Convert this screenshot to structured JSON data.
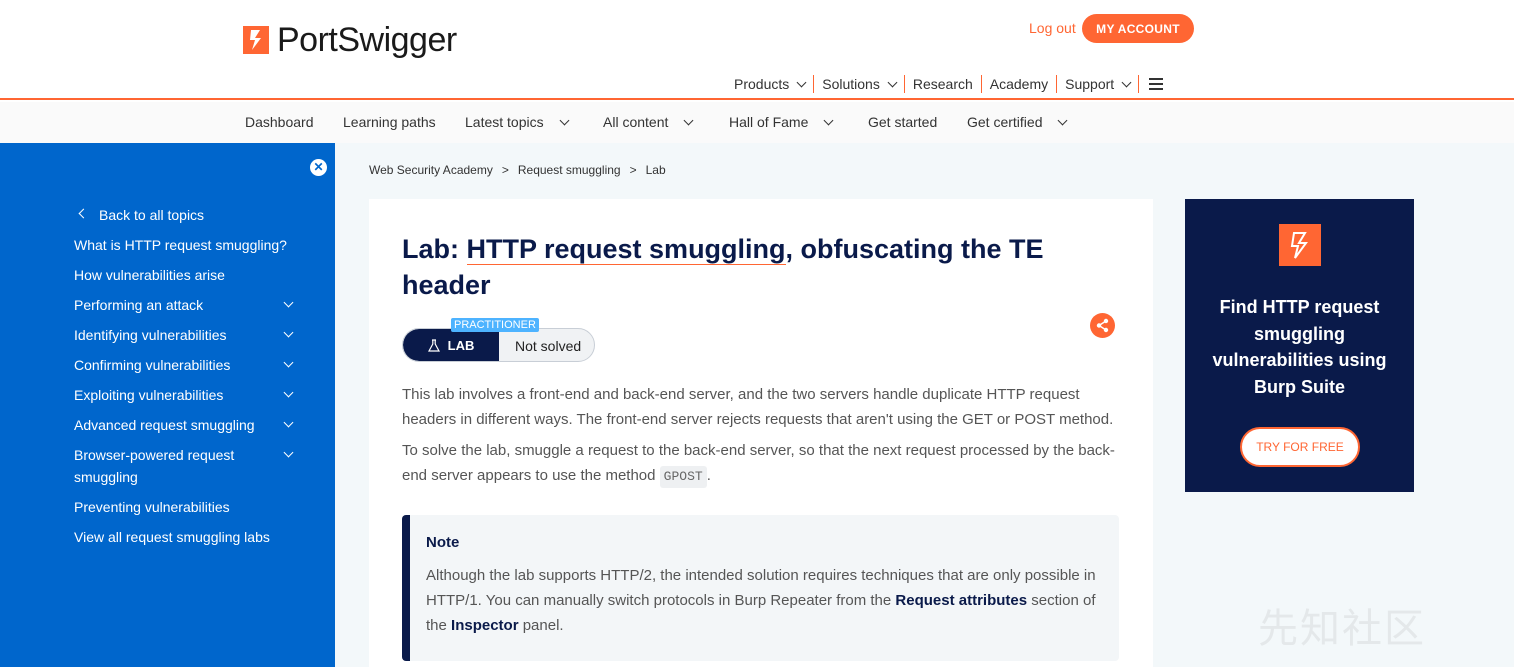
{
  "header": {
    "logo_text": "PortSwigger",
    "logout_label": "Log out",
    "account_label": "MY ACCOUNT",
    "nav": [
      {
        "label": "Products",
        "dropdown": true
      },
      {
        "label": "Solutions",
        "dropdown": true
      },
      {
        "label": "Research",
        "dropdown": false
      },
      {
        "label": "Academy",
        "dropdown": false
      },
      {
        "label": "Support",
        "dropdown": true
      }
    ]
  },
  "subnav": {
    "items": [
      {
        "label": "Dashboard"
      },
      {
        "label": "Learning paths"
      },
      {
        "label": "Latest topics"
      },
      {
        "label": "All content"
      },
      {
        "label": "Hall of Fame"
      },
      {
        "label": "Get started"
      },
      {
        "label": "Get certified"
      }
    ]
  },
  "sidebar": {
    "back_label": "Back to all topics",
    "items": [
      {
        "label": "What is HTTP request smuggling?"
      },
      {
        "label": "How vulnerabilities arise"
      },
      {
        "label": "Performing an attack"
      },
      {
        "label": "Identifying vulnerabilities"
      },
      {
        "label": "Confirming vulnerabilities"
      },
      {
        "label": "Exploiting vulnerabilities"
      },
      {
        "label": "Advanced request smuggling"
      },
      {
        "label": "Browser-powered request smuggling"
      },
      {
        "label": "Preventing vulnerabilities"
      },
      {
        "label": "View all request smuggling labs"
      }
    ]
  },
  "breadcrumb": {
    "items": [
      "Web Security Academy",
      "Request smuggling",
      "Lab"
    ],
    "separator": ">"
  },
  "lab": {
    "title_prefix": "Lab: ",
    "title_link": "HTTP request smuggling",
    "title_suffix": ", obfuscating the TE header",
    "level": "PRACTITIONER",
    "badge_label": "LAB",
    "status": "Not solved",
    "para1": "This lab involves a front-end and back-end server, and the two servers handle duplicate HTTP request headers in different ways. The front-end server rejects requests that aren't using the GET or POST method.",
    "para2_before": "To solve the lab, smuggle a request to the back-end server, so that the next request processed by the back-end server appears to use the method ",
    "para2_code": "GPOST",
    "para2_after": "."
  },
  "note": {
    "title": "Note",
    "text_1": "Although the lab supports HTTP/2, the intended solution requires techniques that are only possible in HTTP/1. You can manually switch protocols in Burp Repeater from the ",
    "bold_1": "Request attributes",
    "text_2": " section of the ",
    "bold_2": "Inspector",
    "text_3": " panel."
  },
  "promo": {
    "text": "Find HTTP request smuggling vulnerabilities using Burp Suite",
    "button_label": "TRY FOR FREE"
  },
  "watermark": "先知社区",
  "colors": {
    "brand_orange": "#ff6633",
    "sidebar_blue": "#0066cc",
    "navy": "#0a1a4a",
    "badge_blue": "#4db3ff"
  }
}
